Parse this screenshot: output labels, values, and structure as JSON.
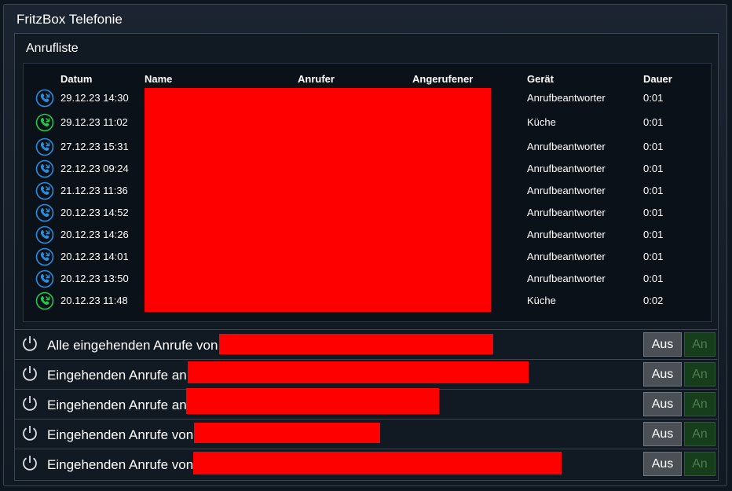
{
  "window": {
    "title": "FritzBox Telefonie"
  },
  "call_list": {
    "title": "Anrufliste",
    "headers": {
      "date": "Datum",
      "name": "Name",
      "caller": "Anrufer",
      "callee": "Angerufener",
      "device": "Gerät",
      "duration": "Dauer"
    },
    "rows": [
      {
        "icon": "voicemail-call-icon",
        "date": "29.12.23 14:30",
        "device": "Anrufbeantworter",
        "duration": "0:01"
      },
      {
        "icon": "incoming-call-icon",
        "date": "29.12.23 11:02",
        "device": "Küche",
        "duration": "0:01"
      },
      {
        "icon": "voicemail-call-icon",
        "date": "27.12.23 15:31",
        "device": "Anrufbeantworter",
        "duration": "0:01"
      },
      {
        "icon": "voicemail-call-icon",
        "date": "22.12.23 09:24",
        "device": "Anrufbeantworter",
        "duration": "0:01"
      },
      {
        "icon": "voicemail-call-icon",
        "date": "21.12.23 11:36",
        "device": "Anrufbeantworter",
        "duration": "0:01"
      },
      {
        "icon": "voicemail-call-icon",
        "date": "20.12.23 14:52",
        "device": "Anrufbeantworter",
        "duration": "0:01"
      },
      {
        "icon": "voicemail-call-icon",
        "date": "20.12.23 14:26",
        "device": "Anrufbeantworter",
        "duration": "0:01"
      },
      {
        "icon": "voicemail-call-icon",
        "date": "20.12.23 14:01",
        "device": "Anrufbeantworter",
        "duration": "0:01"
      },
      {
        "icon": "voicemail-call-icon",
        "date": "20.12.23 13:50",
        "device": "Anrufbeantworter",
        "duration": "0:01"
      },
      {
        "icon": "incoming-call-icon",
        "date": "20.12.23 11:48",
        "device": "Küche",
        "duration": "0:02"
      }
    ]
  },
  "controls": [
    {
      "label": "Alle eingehenden Anrufe von",
      "off_label": "Aus",
      "on_label": "An",
      "state": "off"
    },
    {
      "label": "Eingehenden Anrufe an",
      "off_label": "Aus",
      "on_label": "An",
      "state": "off"
    },
    {
      "label": "Eingehenden Anrufe an",
      "off_label": "Aus",
      "on_label": "An",
      "state": "off"
    },
    {
      "label": "Eingehenden Anrufe von",
      "off_label": "Aus",
      "on_label": "An",
      "state": "off"
    },
    {
      "label": "Eingehenden Anrufe von",
      "off_label": "Aus",
      "on_label": "An",
      "state": "off"
    }
  ],
  "colors": {
    "voicemail_icon": "#2a8ee0",
    "incoming_icon": "#22c84a",
    "redaction": "#ff0000"
  }
}
